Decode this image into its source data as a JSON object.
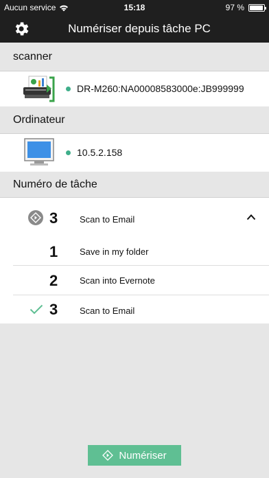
{
  "status_bar": {
    "carrier": "Aucun service",
    "time": "15:18",
    "battery_percent": "97 %",
    "battery_level": 0.97
  },
  "nav": {
    "title": "Numériser depuis tâche PC"
  },
  "scanner_section": {
    "header": "scanner",
    "device": "DR-M260:NA00008583000e:JB999999"
  },
  "computer_section": {
    "header": "Ordinateur",
    "address": "10.5.2.158"
  },
  "task_section": {
    "header": "Numéro de tâche",
    "selected": {
      "number": "3",
      "label": "Scan to Email"
    },
    "tasks": [
      {
        "number": "1",
        "label": "Save in my folder",
        "checked": false
      },
      {
        "number": "2",
        "label": "Scan into Evernote",
        "checked": false
      },
      {
        "number": "3",
        "label": "Scan to Email",
        "checked": true
      }
    ]
  },
  "scan_button": {
    "label": "Numériser"
  },
  "colors": {
    "accent": "#5fbf93",
    "status_dot": "#3fae8a",
    "bar": "#1f1f1f"
  }
}
